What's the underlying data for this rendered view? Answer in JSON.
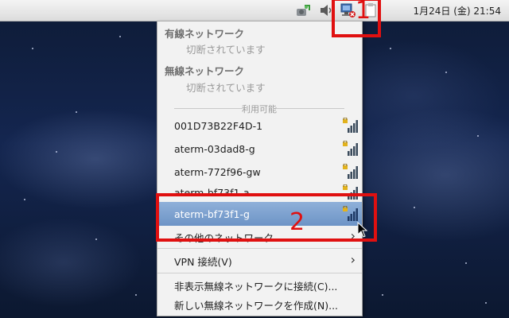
{
  "panel": {
    "clock": "1月24日 (金) 21:54",
    "tray_icons": [
      "updater-icon",
      "volume-icon",
      "network-disconnected-icon",
      "clipboard-icon"
    ]
  },
  "menu": {
    "wired_heading": "有線ネットワーク",
    "wired_status": "切断されています",
    "wireless_heading": "無線ネットワーク",
    "wireless_status": "切断されています",
    "available_label": "利用可能",
    "networks": [
      {
        "ssid": "001D73B22F4D-1",
        "secured": true
      },
      {
        "ssid": "aterm-03dad8-g",
        "secured": true
      },
      {
        "ssid": "aterm-772f96-gw",
        "secured": true
      },
      {
        "ssid": "aterm-bf73f1-a",
        "secured": true
      },
      {
        "ssid": "aterm-bf73f1-g",
        "secured": true,
        "selected": true
      }
    ],
    "other_networks": "その他のネットワーク",
    "vpn": "VPN 接続(V)",
    "connect_hidden": "非表示無線ネットワークに接続(C)...",
    "create_new": "新しい無線ネットワークを作成(N)..."
  },
  "annotations": {
    "step1": "1",
    "step2": "2",
    "color": "#e01010"
  },
  "colors": {
    "selection": "#7aa0cf",
    "menu_bg": "#f2f2f2"
  }
}
